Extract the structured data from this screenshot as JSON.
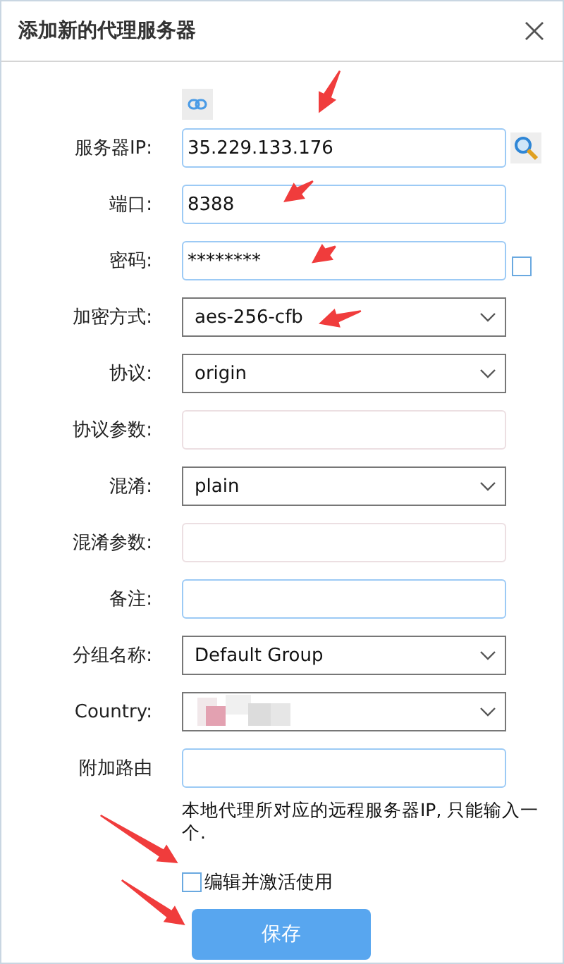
{
  "window": {
    "title": "添加新的代理服务器"
  },
  "fields": [
    {
      "label": "服务器IP:",
      "kind": "text",
      "value": "35.229.133.176",
      "addon": {
        "kind": "search"
      }
    },
    {
      "label": "端口:",
      "kind": "text",
      "value": "8388"
    },
    {
      "label": "密码:",
      "kind": "text",
      "value": "********",
      "addon": {
        "kind": "checkbox",
        "checked": false
      }
    },
    {
      "label": "加密方式:",
      "kind": "select",
      "value": "aes-256-cfb"
    },
    {
      "label": "协议:",
      "kind": "select",
      "value": "origin"
    },
    {
      "label": "协议参数:",
      "kind": "param"
    },
    {
      "label": "混淆:",
      "kind": "select",
      "value": "plain"
    },
    {
      "label": "混淆参数:",
      "kind": "param"
    },
    {
      "label": "备注:",
      "kind": "text"
    },
    {
      "label": "分组名称:",
      "kind": "select",
      "value": "Default Group"
    },
    {
      "label": "Country:",
      "kind": "redacted"
    },
    {
      "label": "附加路由",
      "kind": "text"
    }
  ],
  "hint": "本地代理所对应的远程服务器IP, 只能输入一个.",
  "activate": {
    "label": "编辑并激活使用",
    "checked": false
  },
  "save_button": "保存"
}
